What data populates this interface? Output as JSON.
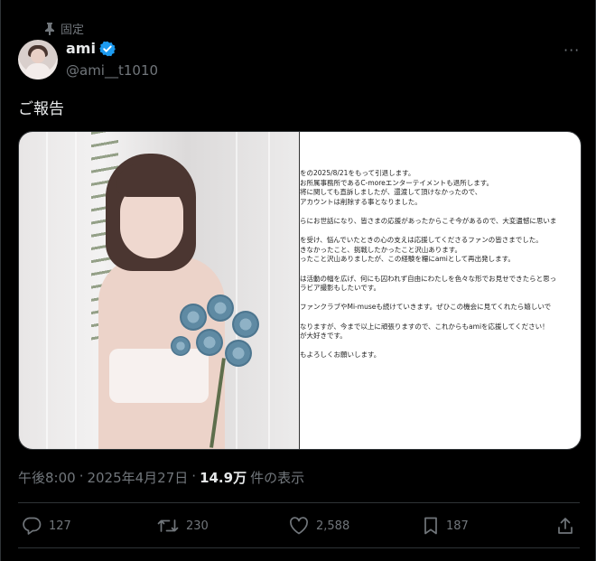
{
  "pinned_label": "固定",
  "author": {
    "name": "ami",
    "handle": "@ami__t1010"
  },
  "post": {
    "text": "ご報告"
  },
  "letter_lines": [
    "をの2025/8/21をもって引退します。",
    "お所属事務所であるC-moreエンターテイメントも退所します。",
    "将に関しても直訴しましたが、還渡して頂けなかったので、",
    "アカウントは削除する事となりました。",
    "",
    "らにお世話になり、皆さまの応援があったからこそ今があるので、大変遺憾に思いま",
    "",
    "を受け、悩んでいたときの心の支えは応援してくださるファンの皆さまでした。",
    "きなかったこと、挑戦したかったこと沢山あります。",
    "ったこと沢山ありましたが、この経験を糧にamiとして再出発します。",
    "",
    "は活動の幅を広げ、何にも囚われず自由にわたしを色々な形でお見せできたらと思っ",
    "ラビア撮影もしたいです。",
    "",
    "ファンクラブやMi-museも続けていきます。ぜひこの機会に見てくれたら嬉しいで",
    "",
    "なりますが、今まで以上に頑張りますので、これからもamiを応援してください！",
    "が大好きです。",
    "",
    "もよろしくお願いします。"
  ],
  "meta": {
    "time": "午後8:00",
    "dot1": "·",
    "date": "2025年4月27日",
    "dot2": "·",
    "views": "14.9万",
    "views_label": "件の表示"
  },
  "actions": {
    "replies": "127",
    "reposts": "230",
    "likes": "2,588",
    "bookmarks": "187"
  },
  "colors": {
    "accent_blue": "#1d9bf0",
    "text_secondary": "#71767b",
    "divider": "#2f3336"
  }
}
